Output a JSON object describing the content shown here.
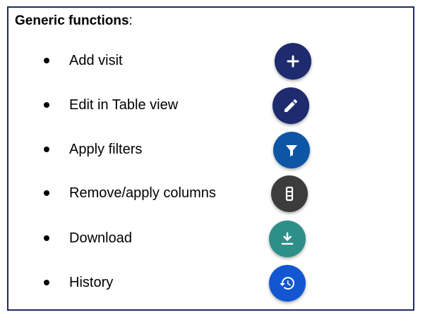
{
  "heading": {
    "bold": "Generic functions",
    "suffix": ":"
  },
  "items": [
    {
      "label": "Add visit",
      "icon": "plus-icon",
      "color": "#1e2b6e"
    },
    {
      "label": "Edit in Table view",
      "icon": "pencil-icon",
      "color": "#1e2b6e"
    },
    {
      "label": "Apply filters",
      "icon": "filter-icon",
      "color": "#0d56a6"
    },
    {
      "label": "Remove/apply columns",
      "icon": "columns-icon",
      "color": "#3c3c3c"
    },
    {
      "label": "Download",
      "icon": "download-icon",
      "color": "#2d8f88"
    },
    {
      "label": "History",
      "icon": "history-icon",
      "color": "#1257d1"
    }
  ]
}
